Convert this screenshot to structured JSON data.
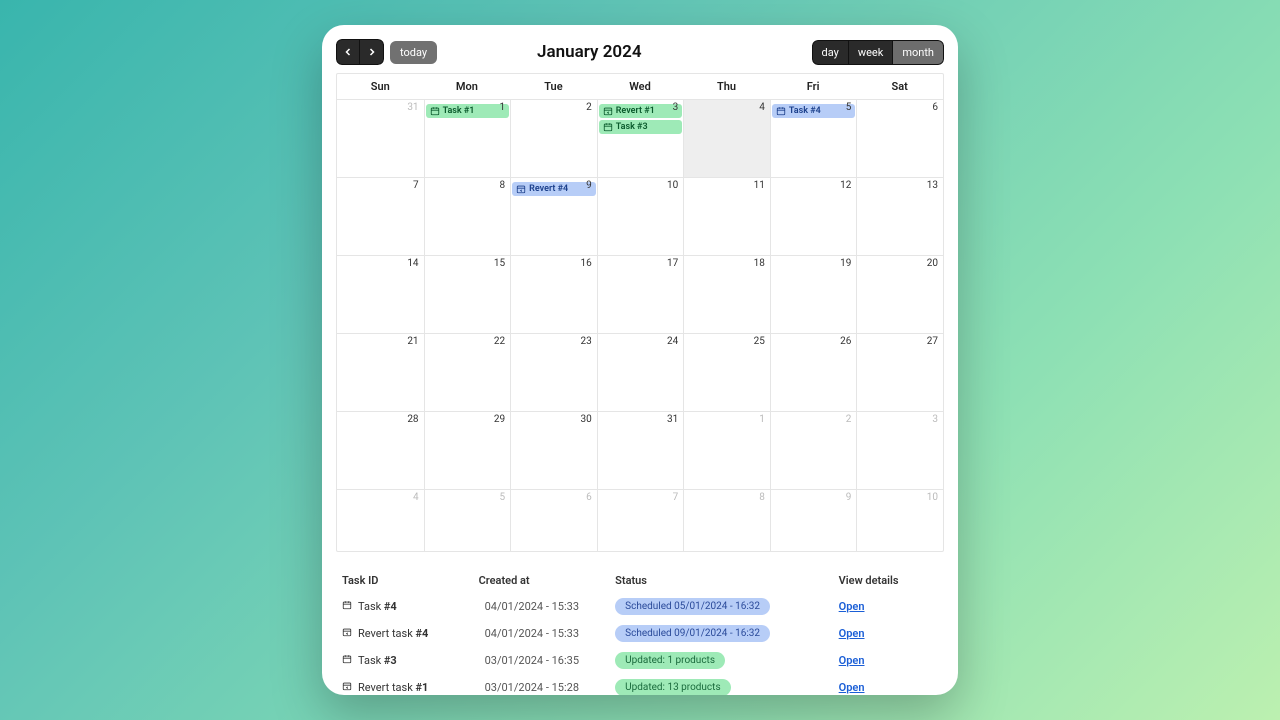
{
  "toolbar": {
    "today_label": "today",
    "title": "January 2024",
    "views": {
      "day": "day",
      "week": "week",
      "month": "month"
    },
    "active_view": "month"
  },
  "days": [
    "Sun",
    "Mon",
    "Tue",
    "Wed",
    "Thu",
    "Fri",
    "Sat"
  ],
  "weeks": [
    [
      {
        "d": "31",
        "other": true
      },
      {
        "d": "1",
        "events": [
          {
            "label": "Task #1",
            "color": "green",
            "icon": "cal"
          }
        ]
      },
      {
        "d": "2"
      },
      {
        "d": "3",
        "events": [
          {
            "label": "Revert #1",
            "color": "green",
            "icon": "revert"
          },
          {
            "label": "Task #3",
            "color": "green",
            "icon": "cal"
          }
        ]
      },
      {
        "d": "4",
        "today": true
      },
      {
        "d": "5",
        "events": [
          {
            "label": "Task #4",
            "color": "blue",
            "icon": "cal"
          }
        ]
      },
      {
        "d": "6"
      }
    ],
    [
      {
        "d": "7"
      },
      {
        "d": "8"
      },
      {
        "d": "9",
        "events": [
          {
            "label": "Revert #4",
            "color": "blue",
            "icon": "revert"
          }
        ]
      },
      {
        "d": "10"
      },
      {
        "d": "11"
      },
      {
        "d": "12"
      },
      {
        "d": "13"
      }
    ],
    [
      {
        "d": "14"
      },
      {
        "d": "15"
      },
      {
        "d": "16"
      },
      {
        "d": "17"
      },
      {
        "d": "18"
      },
      {
        "d": "19"
      },
      {
        "d": "20"
      }
    ],
    [
      {
        "d": "21"
      },
      {
        "d": "22"
      },
      {
        "d": "23"
      },
      {
        "d": "24"
      },
      {
        "d": "25"
      },
      {
        "d": "26"
      },
      {
        "d": "27"
      }
    ],
    [
      {
        "d": "28"
      },
      {
        "d": "29"
      },
      {
        "d": "30"
      },
      {
        "d": "31"
      },
      {
        "d": "1",
        "other": true
      },
      {
        "d": "2",
        "other": true
      },
      {
        "d": "3",
        "other": true
      }
    ],
    [
      {
        "d": "4",
        "other": true
      },
      {
        "d": "5",
        "other": true
      },
      {
        "d": "6",
        "other": true
      },
      {
        "d": "7",
        "other": true
      },
      {
        "d": "8",
        "other": true
      },
      {
        "d": "9",
        "other": true
      },
      {
        "d": "10",
        "other": true
      }
    ]
  ],
  "table": {
    "headers": {
      "id": "Task ID",
      "created": "Created at",
      "status": "Status",
      "view": "View details"
    },
    "open_label": "Open",
    "rows": [
      {
        "icon": "cal",
        "name": "Task ",
        "num": "#4",
        "created": "04/01/2024 - 15:33",
        "status": "Scheduled 05/01/2024 - 16:32",
        "badge": "blue"
      },
      {
        "icon": "revert",
        "name": "Revert task ",
        "num": "#4",
        "created": "04/01/2024 - 15:33",
        "status": "Scheduled 09/01/2024 - 16:32",
        "badge": "blue"
      },
      {
        "icon": "cal",
        "name": "Task ",
        "num": "#3",
        "created": "03/01/2024 - 16:35",
        "status": "Updated: 1 products",
        "badge": "green"
      },
      {
        "icon": "revert",
        "name": "Revert task ",
        "num": "#1",
        "created": "03/01/2024 - 15:28",
        "status": "Updated: 13 products",
        "badge": "green"
      }
    ]
  }
}
